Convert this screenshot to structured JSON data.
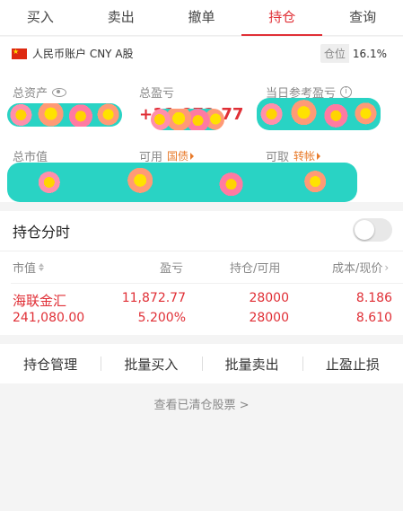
{
  "tabs": [
    {
      "label": "买入"
    },
    {
      "label": "卖出"
    },
    {
      "label": "撤单"
    },
    {
      "label": "持仓"
    },
    {
      "label": "查询"
    }
  ],
  "account": {
    "name": "人民币账户 CNY A股",
    "position_label": "仓位",
    "position_value": "16.1%",
    "total_assets_label": "总资产",
    "total_pnl_label": "总盈亏",
    "total_pnl_partial": "+11,872.77",
    "today_pnl_label": "当日参考盈亏",
    "market_value_label": "总市值",
    "available_label": "可用",
    "available_tag": "国债",
    "withdrawable_label": "可取",
    "withdrawable_tag": "转帐"
  },
  "holdings": {
    "title": "持仓分时",
    "columns": [
      "市值",
      "盈亏",
      "持仓/可用",
      "成本/现价"
    ],
    "rows": [
      {
        "name": "海联金汇",
        "market_value": "241,080.00",
        "pnl": "11,872.77",
        "pnl_pct": "5.200%",
        "position": "28000",
        "available": "28000",
        "cost": "8.186",
        "price": "8.610"
      }
    ]
  },
  "actions": [
    "持仓管理",
    "批量买入",
    "批量卖出",
    "止盈止损"
  ],
  "cleared_link": "查看已清仓股票 >",
  "colors": {
    "accent": "#e02f36",
    "tag": "#e87a2a"
  }
}
